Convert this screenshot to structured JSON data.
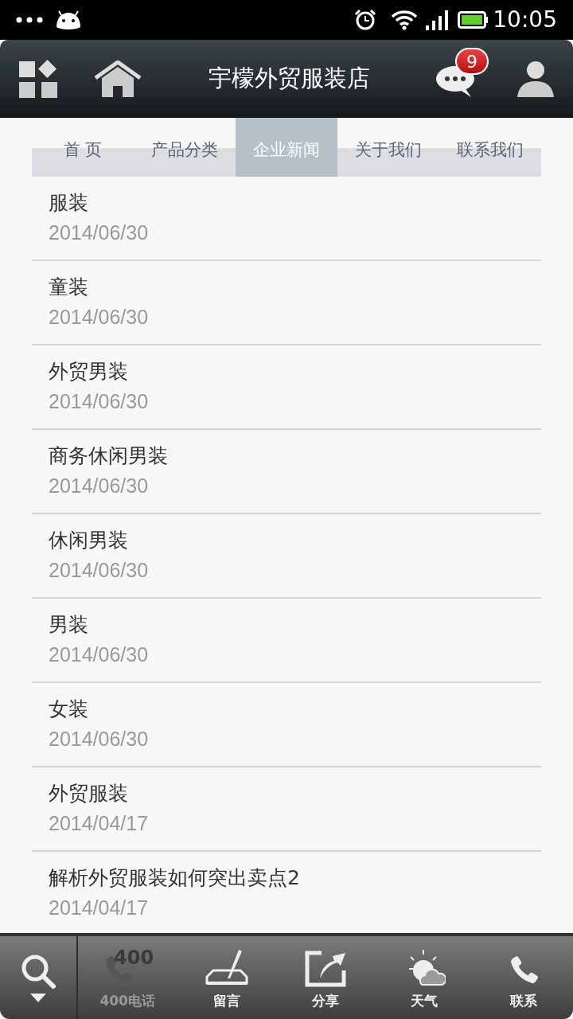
{
  "status_bar": {
    "time": "10:05"
  },
  "header": {
    "title": "宇檬外贸服装店",
    "message_count": "9"
  },
  "tabs": [
    {
      "label": "首 页",
      "selected": false
    },
    {
      "label": "产品分类",
      "selected": false
    },
    {
      "label": "企业新闻",
      "selected": true
    },
    {
      "label": "关于我们",
      "selected": false
    },
    {
      "label": "联系我们",
      "selected": false
    }
  ],
  "news": [
    {
      "title": "服装",
      "date": "2014/06/30"
    },
    {
      "title": "童装",
      "date": "2014/06/30"
    },
    {
      "title": "外贸男装",
      "date": "2014/06/30"
    },
    {
      "title": "商务休闲男装",
      "date": "2014/06/30"
    },
    {
      "title": "休闲男装",
      "date": "2014/06/30"
    },
    {
      "title": "男装",
      "date": "2014/06/30"
    },
    {
      "title": "女装",
      "date": "2014/06/30"
    },
    {
      "title": "外贸服装",
      "date": "2014/04/17"
    },
    {
      "title": "解析外贸服装如何突出卖点2",
      "date": "2014/04/17"
    }
  ],
  "toolbar": [
    {
      "kind": "phone400",
      "icon_text": "400",
      "label": "400电话",
      "disabled": true
    },
    {
      "kind": "message",
      "label": "留言",
      "disabled": false
    },
    {
      "kind": "share",
      "label": "分享",
      "disabled": false
    },
    {
      "kind": "weather",
      "label": "天气",
      "disabled": false
    },
    {
      "kind": "phone",
      "label": "联系",
      "disabled": false
    }
  ]
}
